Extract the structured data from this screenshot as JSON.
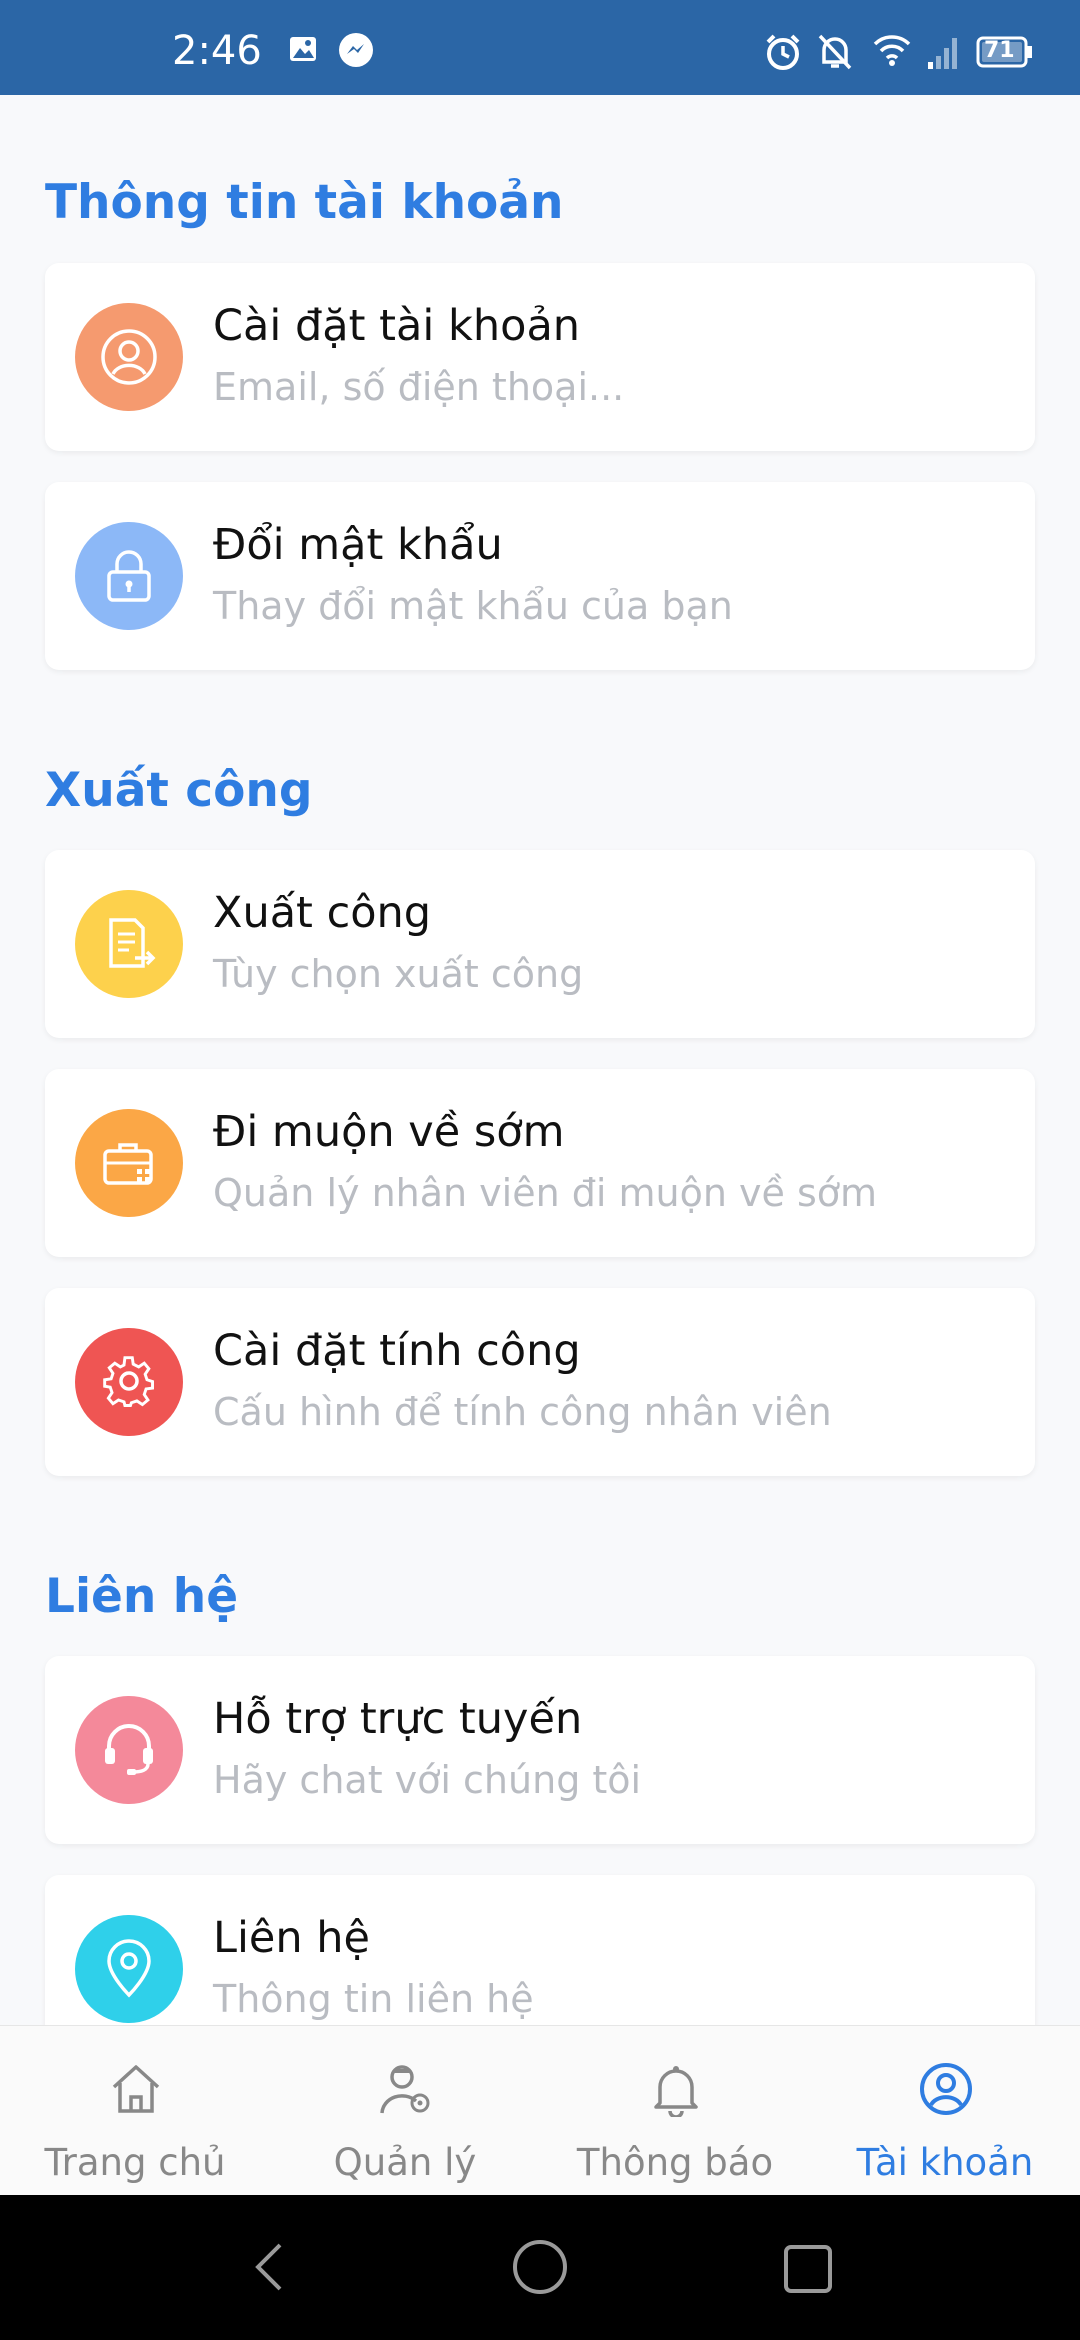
{
  "status_bar": {
    "time": "2:46",
    "battery": "71",
    "icons": [
      "image-icon",
      "messenger-icon",
      "alarm-icon",
      "bell-off-icon",
      "wifi-icon",
      "signal-icon",
      "battery-icon"
    ]
  },
  "sections": [
    {
      "title": "Thông tin tài khoản",
      "items": [
        {
          "title": "Cài đặt tài khoản",
          "subtitle": "Email, số điện thoại...",
          "icon": "user-icon",
          "color": "#f59a6f"
        },
        {
          "title": "Đổi mật khẩu",
          "subtitle": "Thay đổi mật khẩu của bạn",
          "icon": "lock-icon",
          "color": "#8cb8f7"
        }
      ]
    },
    {
      "title": "Xuất công",
      "items": [
        {
          "title": "Xuất công",
          "subtitle": "Tùy chọn xuất công",
          "icon": "document-export-icon",
          "color": "#fdd14c"
        },
        {
          "title": "Đi muộn về sớm",
          "subtitle": "Quản lý nhân viên đi muộn về sớm",
          "icon": "briefcase-icon",
          "color": "#fba746"
        },
        {
          "title": "Cài đặt tính công",
          "subtitle": "Cấu hình để tính công nhân viên",
          "icon": "gear-icon",
          "color": "#ef5553"
        }
      ]
    },
    {
      "title": "Liên hệ",
      "items": [
        {
          "title": "Hỗ trợ trực tuyến",
          "subtitle": "Hãy chat với chúng tôi",
          "icon": "headset-icon",
          "color": "#f4899a"
        },
        {
          "title": "Liên hệ",
          "subtitle": "Thông tin liên hệ",
          "icon": "location-pin-icon",
          "color": "#2fd0ea"
        }
      ]
    }
  ],
  "tabs": [
    {
      "label": "Trang chủ",
      "icon": "home-icon",
      "active": false
    },
    {
      "label": "Quản lý",
      "icon": "manager-icon",
      "active": false
    },
    {
      "label": "Thông báo",
      "icon": "bell-icon",
      "active": false
    },
    {
      "label": "Tài khoản",
      "icon": "account-icon",
      "active": true
    }
  ],
  "colors": {
    "accent": "#2f7de1",
    "status_bar": "#2b66a6",
    "subtitle": "#b9bcc2"
  }
}
